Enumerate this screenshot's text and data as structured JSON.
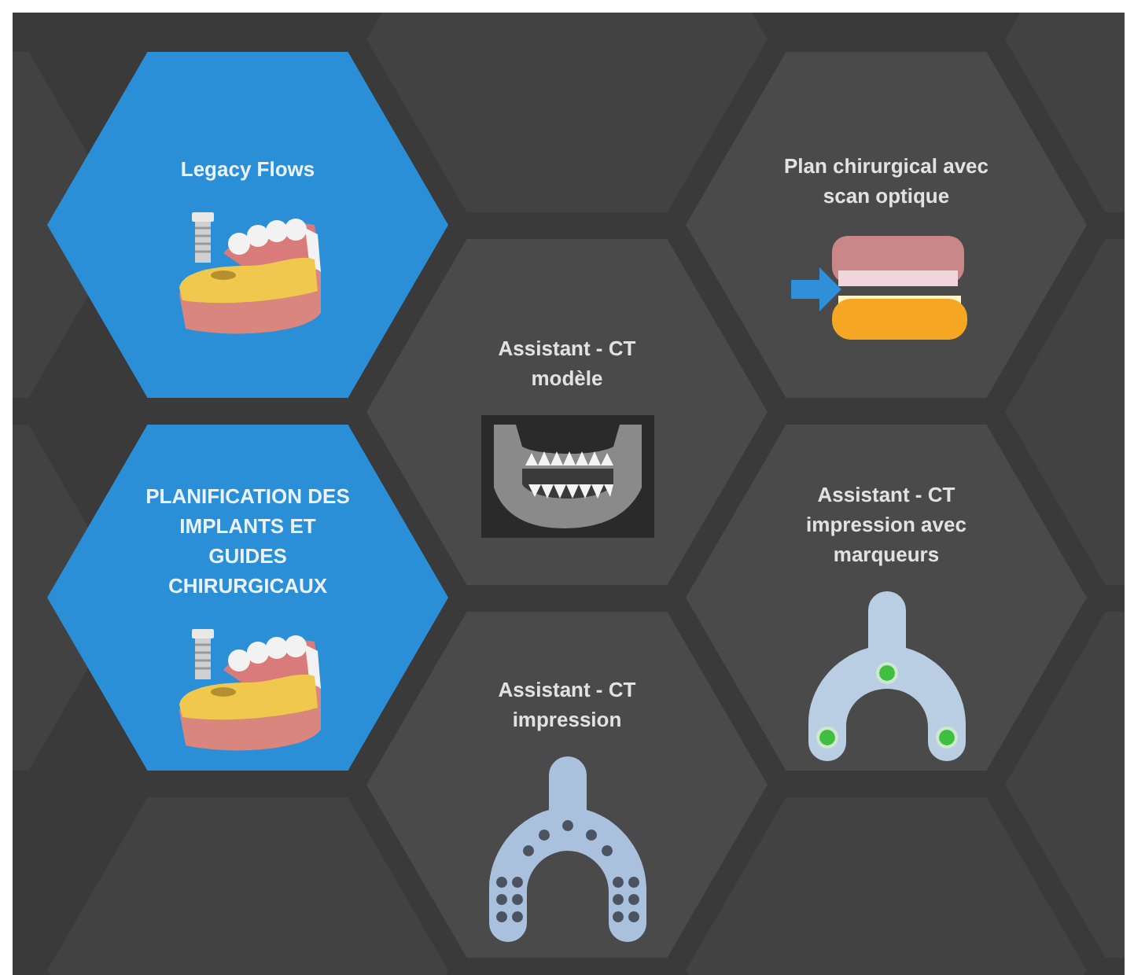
{
  "tiles": [
    {
      "title": "Legacy Flows",
      "kind": "implant",
      "selected": true
    },
    {
      "title": "PLANIFICATION DES IMPLANTS ET GUIDES CHIRURGICAUX",
      "kind": "implant",
      "selected": true
    },
    {
      "title": "Assistant - CT modèle",
      "kind": "xray",
      "selected": false
    },
    {
      "title": "Assistant - CT impression",
      "kind": "tray",
      "selected": false
    },
    {
      "title": "Plan chirurgical avec scan optique",
      "kind": "scan",
      "selected": false
    },
    {
      "title": "Assistant - CT impression avec marqueurs",
      "kind": "tray-markers",
      "selected": false
    }
  ]
}
